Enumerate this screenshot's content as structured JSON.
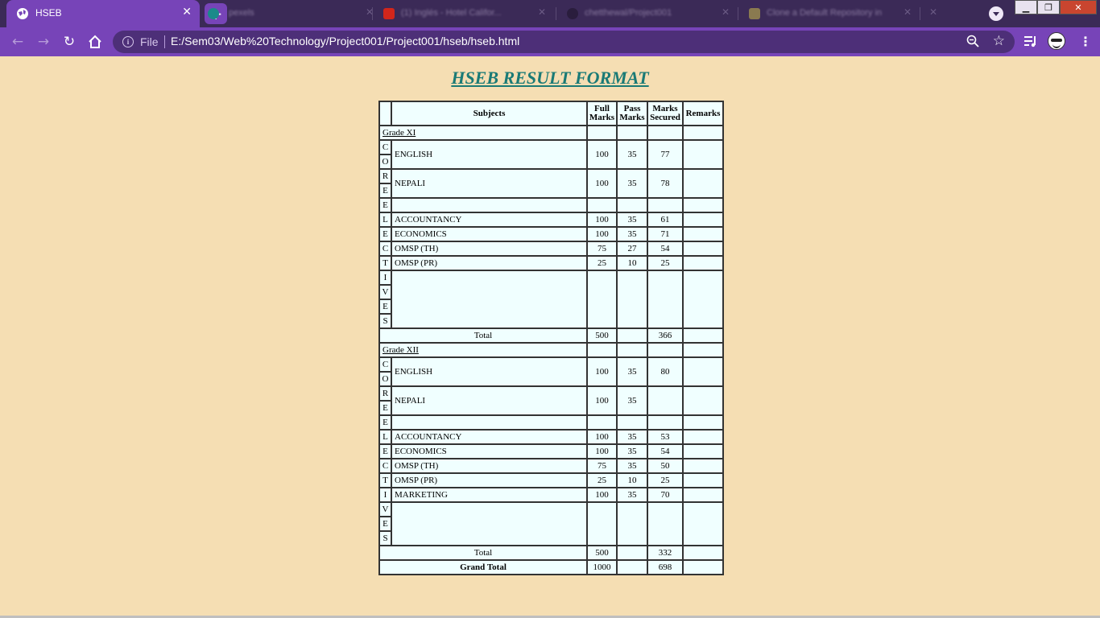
{
  "browser": {
    "tab_title": "HSEB",
    "other_tabs": [
      "pexels",
      "(1) Inglés - Hotel Califor...",
      "chetthewal/Project001",
      "Clone a Default Repository in"
    ],
    "file_label": "File",
    "url": "E:/Sem03/Web%20Technology/Project001/Project001/hseb/hseb.html"
  },
  "page": {
    "title": "HSEB RESULT FORMAT"
  },
  "table": {
    "headers": {
      "subjects": "Subjects",
      "full_1": "Full",
      "full_2": "Marks",
      "pass_1": "Pass",
      "pass_2": "Marks",
      "sec_1": "Marks",
      "sec_2": "Secured",
      "remarks": "Remarks"
    },
    "grade11": {
      "label": "Grade XI",
      "english": {
        "name": "ENGLISH",
        "full": "100",
        "pass": "35",
        "sec": "77"
      },
      "nepali": {
        "name": "NEPALI",
        "full": "100",
        "pass": "35",
        "sec": "78"
      },
      "accountancy": {
        "name": "ACCOUNTANCY",
        "full": "100",
        "pass": "35",
        "sec": "61"
      },
      "economics": {
        "name": "ECONOMICS",
        "full": "100",
        "pass": "35",
        "sec": "71"
      },
      "omsp_th": {
        "name": "OMSP (TH)",
        "full": "75",
        "pass": "27",
        "sec": "54"
      },
      "omsp_pr": {
        "name": "OMSP (PR)",
        "full": "25",
        "pass": "10",
        "sec": "25"
      },
      "total": {
        "label": "Total",
        "full": "500",
        "sec": "366"
      }
    },
    "grade12": {
      "label": "Grade XII",
      "english": {
        "name": "ENGLISH",
        "full": "100",
        "pass": "35",
        "sec": "80"
      },
      "nepali": {
        "name": "NEPALI",
        "full": "100",
        "pass": "35",
        "sec": ""
      },
      "accountancy": {
        "name": "ACCOUNTANCY",
        "full": "100",
        "pass": "35",
        "sec": "53"
      },
      "economics": {
        "name": "ECONOMICS",
        "full": "100",
        "pass": "35",
        "sec": "54"
      },
      "omsp_th": {
        "name": "OMSP (TH)",
        "full": "75",
        "pass": "35",
        "sec": "50"
      },
      "omsp_pr": {
        "name": "OMSP (PR)",
        "full": "25",
        "pass": "10",
        "sec": "25"
      },
      "marketing": {
        "name": "MARKETING",
        "full": "100",
        "pass": "35",
        "sec": "70"
      },
      "total": {
        "label": "Total",
        "full": "500",
        "sec": "332"
      }
    },
    "grand_total": {
      "label": "Grand Total",
      "full": "1000",
      "sec": "698"
    },
    "letters": {
      "c": "C",
      "o": "O",
      "r": "R",
      "e": "E",
      "l": "L",
      "t": "T",
      "i": "I",
      "v": "V",
      "s": "S"
    }
  }
}
